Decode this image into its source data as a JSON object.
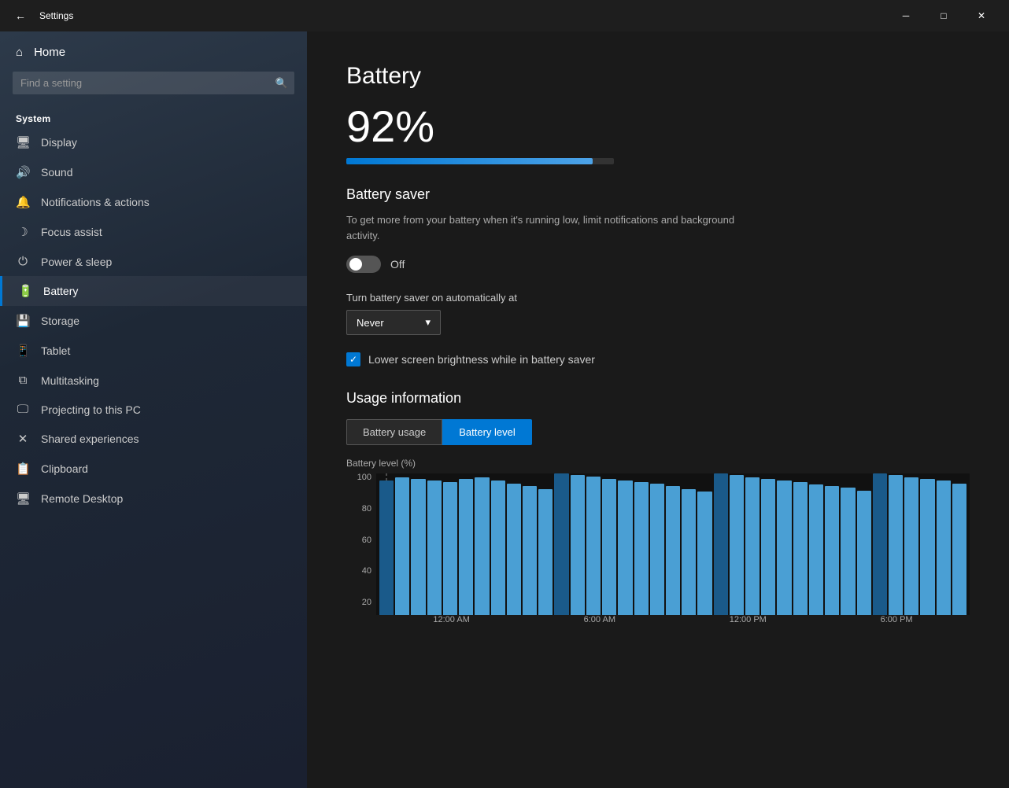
{
  "titlebar": {
    "back_label": "←",
    "title": "Settings",
    "minimize_label": "─",
    "maximize_label": "□",
    "close_label": "✕"
  },
  "sidebar": {
    "home_label": "Home",
    "search_placeholder": "Find a setting",
    "section_label": "System",
    "items": [
      {
        "id": "display",
        "icon": "⬜",
        "label": "Display"
      },
      {
        "id": "sound",
        "icon": "🔊",
        "label": "Sound"
      },
      {
        "id": "notifications",
        "icon": "☐",
        "label": "Notifications & actions"
      },
      {
        "id": "focus",
        "icon": "☾",
        "label": "Focus assist"
      },
      {
        "id": "power",
        "icon": "⏻",
        "label": "Power & sleep"
      },
      {
        "id": "battery",
        "icon": "🔋",
        "label": "Battery",
        "active": true
      },
      {
        "id": "storage",
        "icon": "💾",
        "label": "Storage"
      },
      {
        "id": "tablet",
        "icon": "📱",
        "label": "Tablet"
      },
      {
        "id": "multitasking",
        "icon": "⧉",
        "label": "Multitasking"
      },
      {
        "id": "projecting",
        "icon": "🖥",
        "label": "Projecting to this PC"
      },
      {
        "id": "shared",
        "icon": "✕",
        "label": "Shared experiences"
      },
      {
        "id": "clipboard",
        "icon": "📋",
        "label": "Clipboard"
      },
      {
        "id": "remote",
        "icon": "🖥",
        "label": "Remote Desktop"
      }
    ]
  },
  "content": {
    "page_title": "Battery",
    "battery_percent": "92%",
    "battery_fill_width": "92%",
    "battery_saver": {
      "section_title": "Battery saver",
      "description": "To get more from your battery when it's running low, limit notifications and background activity.",
      "toggle_state": "Off",
      "auto_label": "Turn battery saver on automatically at",
      "dropdown_value": "Never",
      "checkbox_label": "Lower screen brightness while in battery saver",
      "checkbox_checked": true
    },
    "usage": {
      "section_title": "Usage information",
      "chart_label": "Battery level (%)",
      "tab_usage": "Battery usage",
      "tab_level": "Battery level",
      "active_tab": "Battery level",
      "y_labels": [
        "100",
        "80",
        "60",
        "40",
        "20"
      ],
      "x_labels": [
        "12:00 AM",
        "6:00 AM",
        "12:00 PM",
        "6:00 PM"
      ],
      "bars": [
        95,
        97,
        96,
        95,
        94,
        96,
        97,
        95,
        93,
        91,
        89,
        100,
        99,
        98,
        96,
        95,
        94,
        93,
        91,
        89,
        87,
        100,
        99,
        97,
        96,
        95,
        94,
        92,
        91,
        90,
        88,
        100,
        99,
        97,
        96,
        95,
        93
      ]
    }
  }
}
